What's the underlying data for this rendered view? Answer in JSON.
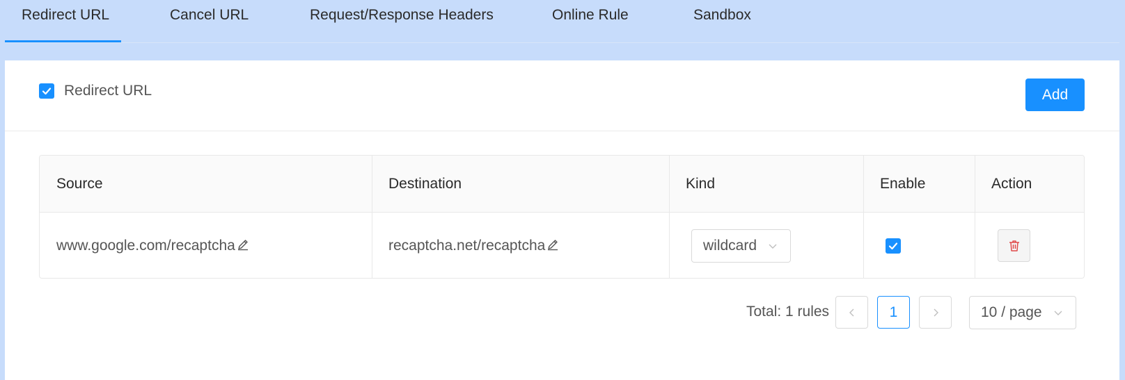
{
  "tabs": [
    {
      "label": "Redirect URL",
      "active": true
    },
    {
      "label": "Cancel URL",
      "active": false
    },
    {
      "label": "Request/Response Headers",
      "active": false
    },
    {
      "label": "Online Rule",
      "active": false
    },
    {
      "label": "Sandbox",
      "active": false
    }
  ],
  "header": {
    "checkbox_label": "Redirect URL",
    "checked": true,
    "add_label": "Add"
  },
  "table": {
    "columns": [
      "Source",
      "Destination",
      "Kind",
      "Enable",
      "Action"
    ],
    "rows": [
      {
        "source": "www.google.com/recaptcha",
        "destination": "recaptcha.net/recaptcha",
        "kind": "wildcard",
        "enabled": true
      }
    ]
  },
  "pagination": {
    "total_text": "Total: 1 rules",
    "current_page": "1",
    "page_size": "10 / page"
  },
  "colors": {
    "accent": "#1890ff",
    "tab_bar_bg": "#c7dcfb",
    "delete_red": "#e04a4a"
  },
  "icons": [
    "check-icon",
    "edit-icon",
    "chevron-down-icon",
    "delete-icon",
    "chevron-left-icon",
    "chevron-right-icon"
  ]
}
